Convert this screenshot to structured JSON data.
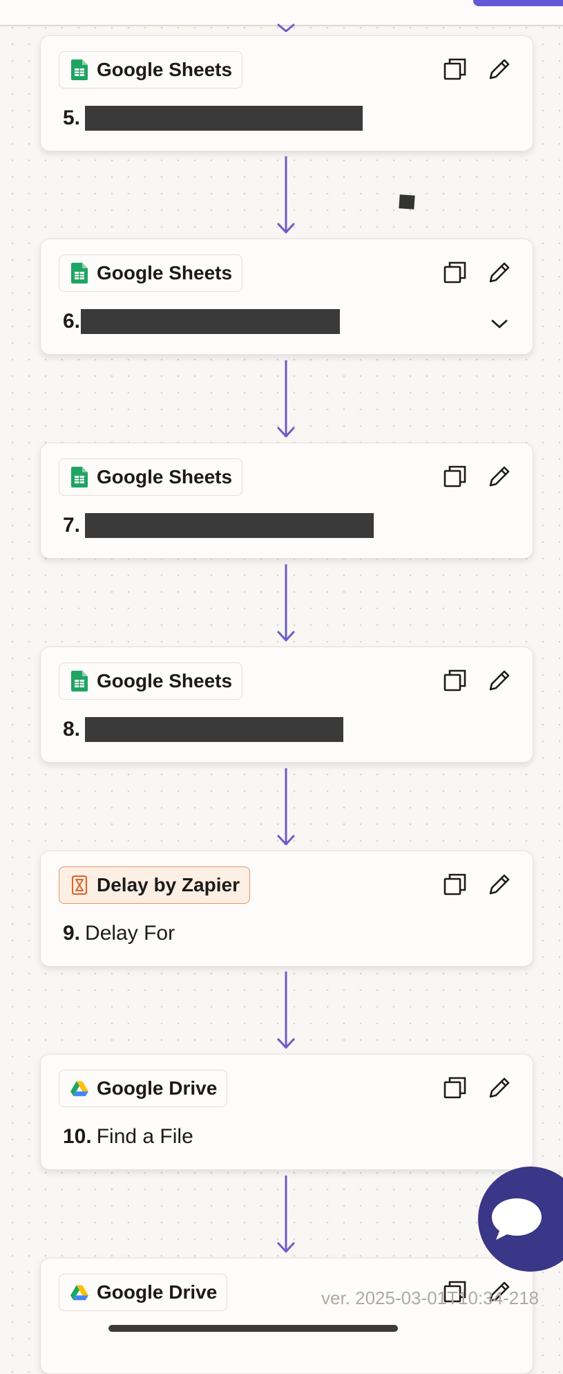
{
  "steps": [
    {
      "number": "5.",
      "app": "Google Sheets",
      "app_icon": "google-sheets-icon",
      "title": "",
      "redacted": true
    },
    {
      "number": "6.",
      "app": "Google Sheets",
      "app_icon": "google-sheets-icon",
      "title": "",
      "redacted": true,
      "expandable": true
    },
    {
      "number": "7.",
      "app": "Google Sheets",
      "app_icon": "google-sheets-icon",
      "title": "",
      "redacted": true
    },
    {
      "number": "8.",
      "app": "Google Sheets",
      "app_icon": "google-sheets-icon",
      "title": "",
      "redacted": true
    },
    {
      "number": "9.",
      "app": "Delay by Zapier",
      "app_icon": "hourglass-icon",
      "title": "Delay For"
    },
    {
      "number": "10.",
      "app": "Google Drive",
      "app_icon": "google-drive-icon",
      "title": "Find a File"
    },
    {
      "app": "Google Drive",
      "app_icon": "google-drive-icon"
    }
  ],
  "version_text": "ver. 2025-03-01T10:34-218",
  "colors": {
    "accent": "#6657d6",
    "connector": "#6c5cc9",
    "chat_button": "#3a3688",
    "sheets_green": "#1fa463",
    "delay_orange": "#e4956a"
  },
  "icons": [
    "copy-icon",
    "pencil-icon",
    "chevron-down-icon",
    "chat-bubble-icon"
  ]
}
